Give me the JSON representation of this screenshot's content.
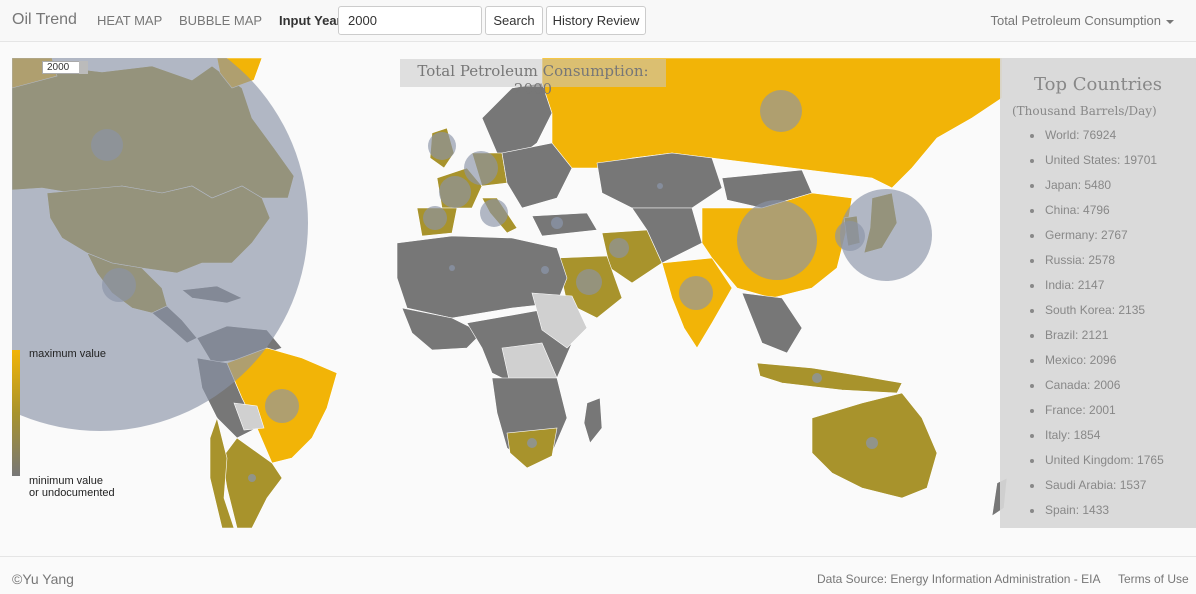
{
  "nav": {
    "brand": "Oil Trend",
    "heat_map": "HEAT MAP",
    "bubble_map": "BUBBLE MAP",
    "input_label": "Input Year",
    "input_value": "2000",
    "search_label": "Search",
    "history_label": "History Review",
    "metric_selected": "Total Petroleum Consumption"
  },
  "map": {
    "year_box": "2000",
    "title": "Total Petroleum Consumption: 2000",
    "colors": {
      "max": "#f2b407",
      "mid": "#a8932c",
      "min": "#777777",
      "undocumented": "#d0d0d0",
      "bubble": "#8a94a8"
    }
  },
  "legend": {
    "max_label": "maximum value",
    "min_label_1": "minimum value",
    "min_label_2": "or undocumented"
  },
  "top_countries": {
    "title": "Top Countries",
    "unit": "(Thousand Barrels/Day)",
    "items": [
      {
        "country": "World",
        "value": 76924,
        "text": "World: 76924"
      },
      {
        "country": "United States",
        "value": 19701,
        "text": "United States: 19701"
      },
      {
        "country": "Japan",
        "value": 5480,
        "text": "Japan: 5480"
      },
      {
        "country": "China",
        "value": 4796,
        "text": "China: 4796"
      },
      {
        "country": "Germany",
        "value": 2767,
        "text": "Germany: 2767"
      },
      {
        "country": "Russia",
        "value": 2578,
        "text": "Russia: 2578"
      },
      {
        "country": "India",
        "value": 2147,
        "text": "India: 2147"
      },
      {
        "country": "South Korea",
        "value": 2135,
        "text": "South Korea: 2135"
      },
      {
        "country": "Brazil",
        "value": 2121,
        "text": "Brazil: 2121"
      },
      {
        "country": "Mexico",
        "value": 2096,
        "text": "Mexico: 2096"
      },
      {
        "country": "Canada",
        "value": 2006,
        "text": "Canada: 2006"
      },
      {
        "country": "France",
        "value": 2001,
        "text": "France: 2001"
      },
      {
        "country": "Italy",
        "value": 1854,
        "text": "Italy: 1854"
      },
      {
        "country": "United Kingdom",
        "value": 1765,
        "text": "United Kingdom: 1765"
      },
      {
        "country": "Saudi Arabia",
        "value": 1537,
        "text": "Saudi Arabia: 1537"
      },
      {
        "country": "Spain",
        "value": 1433,
        "text": "Spain: 1433"
      }
    ]
  },
  "footer": {
    "copyright": "©Yu Yang",
    "source": "Data Source: Energy Information Administration - EIA",
    "terms": "Terms of Use"
  }
}
